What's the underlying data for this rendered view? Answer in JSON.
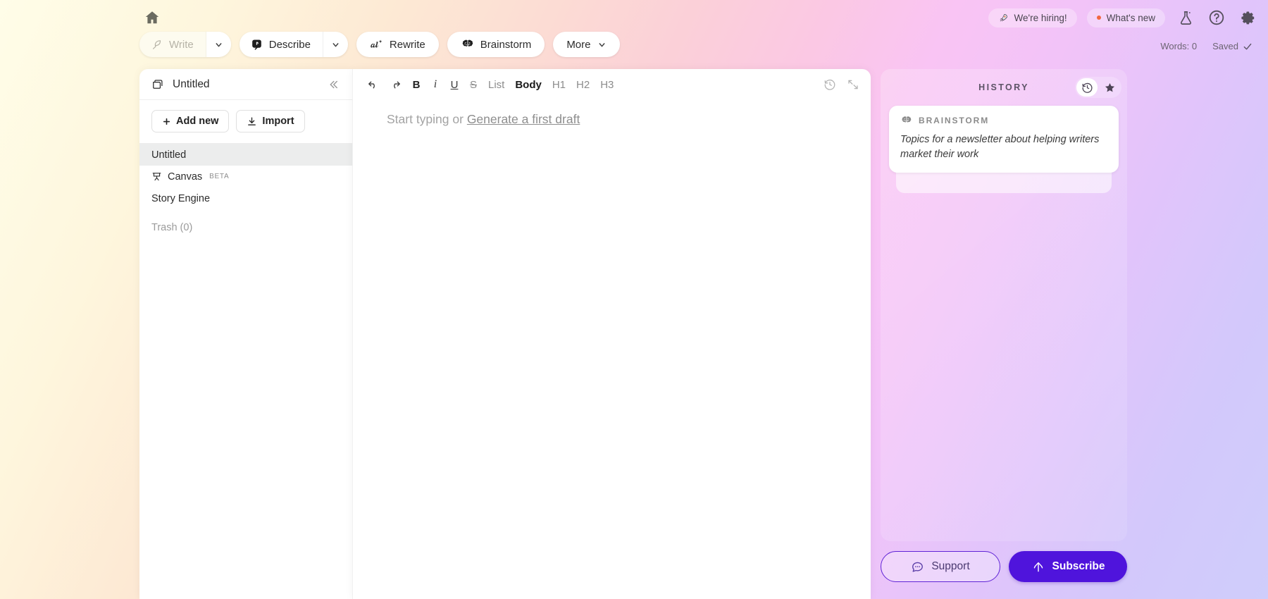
{
  "topbar": {
    "home_icon": "home-icon",
    "tools": [
      {
        "label": "Write",
        "icon": "feather-icon",
        "has_caret": true,
        "disabled": true
      },
      {
        "label": "Describe",
        "icon": "describe-icon",
        "has_caret": true,
        "disabled": false
      },
      {
        "label": "Rewrite",
        "icon": "rewrite-sparkle-icon",
        "has_caret": false,
        "disabled": false
      },
      {
        "label": "Brainstorm",
        "icon": "brain-icon",
        "has_caret": false,
        "disabled": false
      }
    ],
    "more_label": "More",
    "chips": [
      {
        "label": "We're hiring!",
        "icon": "rocket-icon"
      },
      {
        "label": "What's new",
        "icon": "dot-icon"
      }
    ],
    "icons": [
      {
        "name": "lab-flask-icon"
      },
      {
        "name": "help-circle-icon"
      },
      {
        "name": "gear-icon"
      }
    ],
    "word_count": "Words: 0",
    "save_status": "Saved"
  },
  "sidebar": {
    "title": "Untitled",
    "title_icon": "folder-icon",
    "collapse_icon": "chevrons-left-icon",
    "add_new_label": "Add new",
    "import_label": "Import",
    "items": [
      {
        "label": "Untitled",
        "active": true,
        "icon": null,
        "badge": null,
        "muted": false
      },
      {
        "label": "Canvas",
        "active": false,
        "icon": "easel-icon",
        "badge": "BETA",
        "muted": false
      },
      {
        "label": "Story Engine",
        "active": false,
        "icon": null,
        "badge": null,
        "muted": false
      },
      {
        "label": "Trash (0)",
        "active": false,
        "icon": null,
        "badge": null,
        "muted": true
      }
    ]
  },
  "editor": {
    "toolbar": [
      {
        "label": "undo",
        "kind": "icon-undo"
      },
      {
        "label": "redo",
        "kind": "icon-redo"
      },
      {
        "label": "B",
        "kind": "bold"
      },
      {
        "label": "i",
        "kind": "ital"
      },
      {
        "label": "U",
        "kind": "under"
      },
      {
        "label": "S",
        "kind": "strike"
      },
      {
        "label": "List",
        "kind": "gray"
      },
      {
        "label": "Body",
        "kind": "active"
      },
      {
        "label": "H1",
        "kind": "gray"
      },
      {
        "label": "H2",
        "kind": "gray"
      },
      {
        "label": "H3",
        "kind": "gray"
      }
    ],
    "right_icons": [
      {
        "name": "history-clock-icon"
      },
      {
        "name": "expand-arrows-icon"
      }
    ],
    "placeholder_prefix": "Start typing or ",
    "placeholder_link": "Generate a first draft"
  },
  "history": {
    "title": "HISTORY",
    "toggle": [
      {
        "name": "history-clock-icon",
        "active": true
      },
      {
        "name": "star-icon",
        "active": false
      }
    ],
    "cards": [
      {
        "label": "BRAINSTORM",
        "icon": "brain-icon",
        "text": "Topics for a newsletter about helping writers market their work"
      }
    ]
  },
  "footer": {
    "support_label": "Support",
    "support_icon": "chat-bubble-icon",
    "subscribe_label": "Subscribe",
    "subscribe_icon": "up-arrow-icon"
  },
  "colors": {
    "accent_purple": "#4f14dc",
    "support_border": "#6023d6",
    "active_row": "#eceded",
    "notification_dot": "#f2683f"
  }
}
